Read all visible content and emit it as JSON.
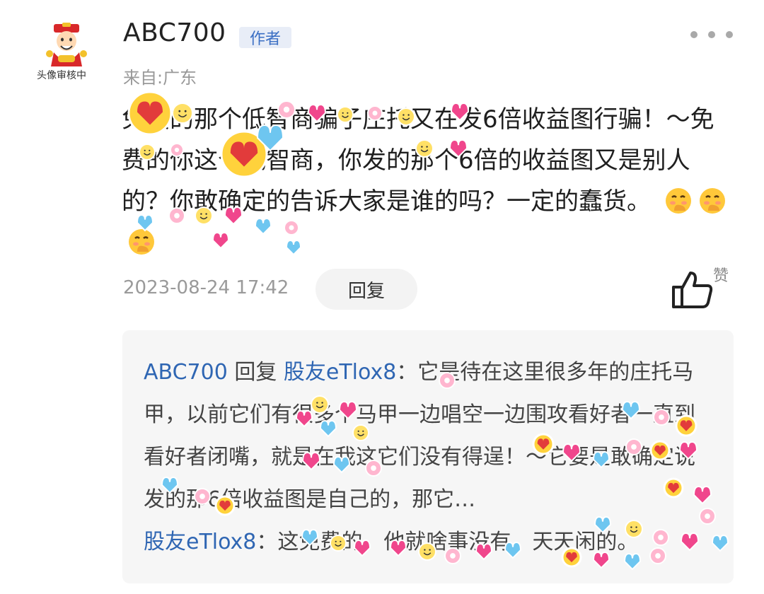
{
  "comment": {
    "avatar_caption": "头像审核中",
    "username": "ABC700",
    "author_badge": "作者",
    "location": "来自:广东",
    "text": "免费的那个低智商骗子庄托又在发6倍收益图行骗！～免费的你这个低智商，你发的那个6倍的收益图又是别人的？你敢确定的告诉大家是谁的吗？一定的蠢货。",
    "emoji_icons": [
      "hand-over-mouth-emoji-icon",
      "hand-over-mouth-emoji-icon",
      "hand-over-mouth-emoji-icon"
    ],
    "timestamp": "2023-08-24 17:42",
    "reply_label": "回复",
    "like_label": "赞"
  },
  "reply": {
    "author": "ABC700",
    "verb": "回复",
    "target": "股友eTlox8",
    "separator": "：",
    "text1": "它是待在这里很多年的庄托马甲，以前它们有很多个马甲一边唱空一边围攻看好者一直到看好者闭嘴，就是在我这它们没有得逞！～它要是敢确定说发的那6倍收益图是自己的，那它…",
    "nested_author": "股友eTlox8",
    "nested_separator": "：",
    "text2": "这免费的，他就啥事没有，天天闲的。"
  },
  "stickers": {
    "names": [
      "sugar-with-love-sticker",
      "smiley-heart-sticker",
      "love-heart-sticker",
      "donut-sticker"
    ],
    "colors": {
      "pink": "#f0468c",
      "yellow": "#ffd23c",
      "blue": "#6ec6f0",
      "red": "#e23b3b"
    }
  }
}
